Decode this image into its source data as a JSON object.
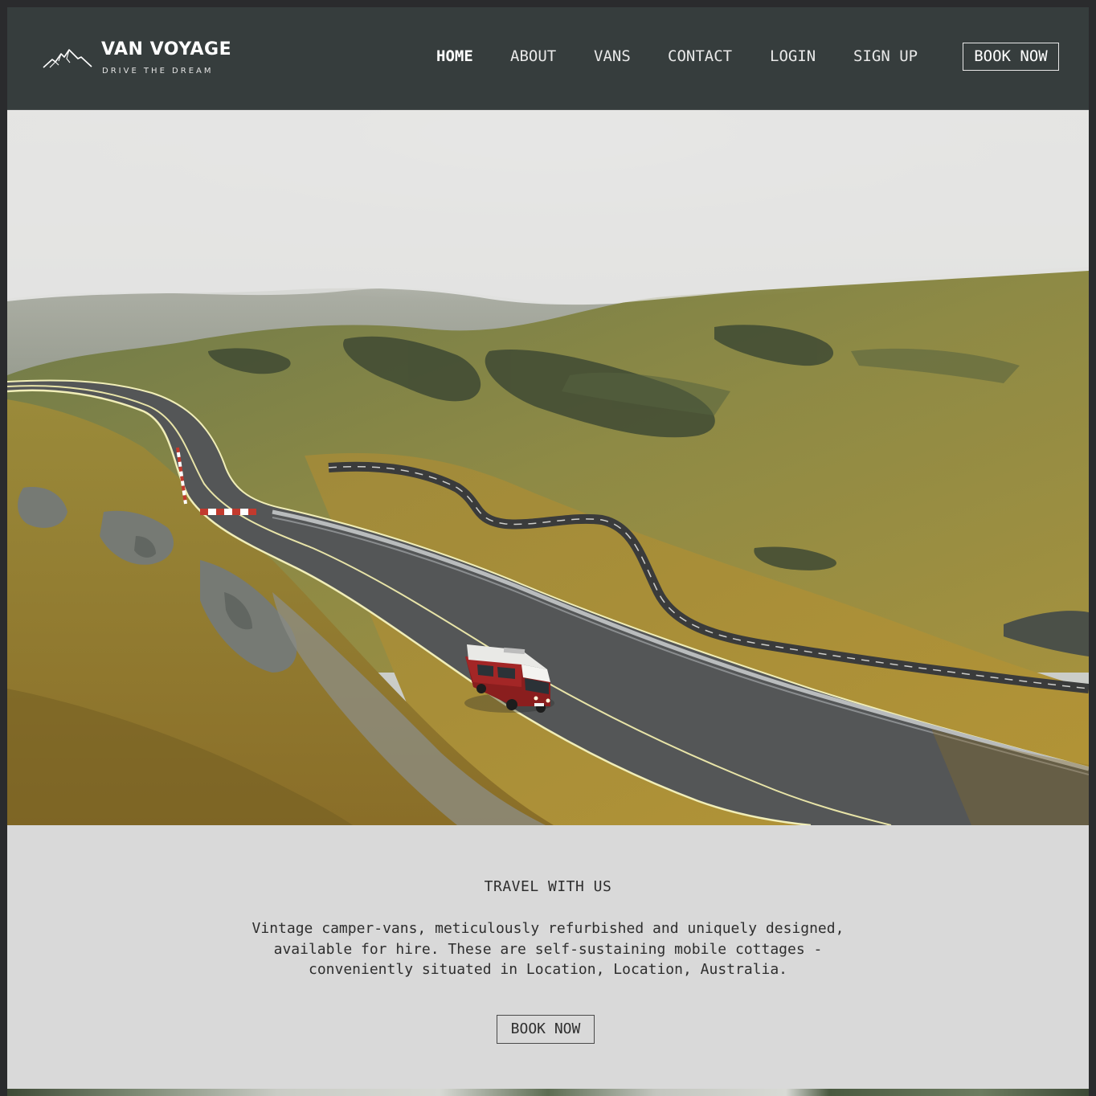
{
  "header": {
    "brand": "VAN VOYAGE",
    "tagline": "DRIVE THE DREAM",
    "logo_icon": "mountain-icon",
    "nav": [
      {
        "label": "HOME",
        "active": true
      },
      {
        "label": "ABOUT",
        "active": false
      },
      {
        "label": "VANS",
        "active": false
      },
      {
        "label": "CONTACT",
        "active": false
      },
      {
        "label": "LOGIN",
        "active": false
      },
      {
        "label": "SIGN UP",
        "active": false
      }
    ],
    "cta": "BOOK NOW"
  },
  "intro": {
    "heading": "TRAVEL WITH US",
    "body": "Vintage camper-vans, meticulously refurbished and uniquely designed, available for hire. These are self-sustaining mobile cottages - conveniently situated in Location, Location, Australia.",
    "cta": "BOOK NOW"
  },
  "colors": {
    "header_bg": "#363d3d",
    "section_bg": "#d9d9d9",
    "page_border": "#2a2b2d",
    "text_dark": "#2e2e2e"
  }
}
